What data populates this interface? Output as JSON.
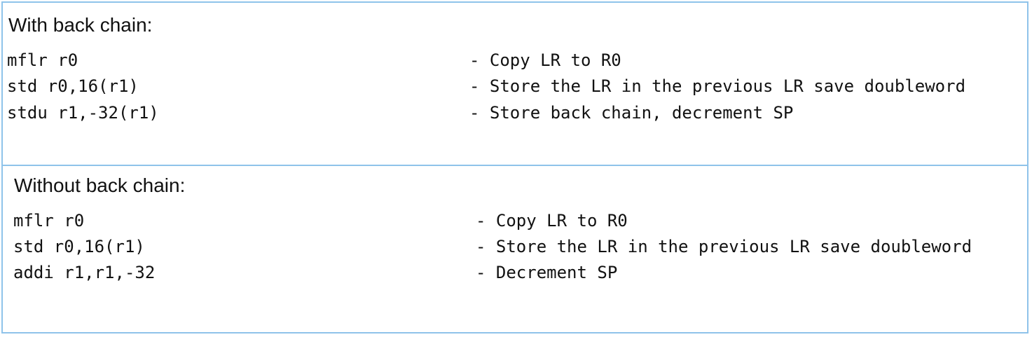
{
  "sections": [
    {
      "heading": "With back chain:",
      "rows": [
        {
          "instruction": "mflr r0",
          "description": "- Copy LR to R0"
        },
        {
          "instruction": "std r0,16(r1)",
          "description": "- Store the LR in the previous LR save doubleword"
        },
        {
          "instruction": "stdu r1,-32(r1)",
          "description": "- Store back chain, decrement SP"
        }
      ]
    },
    {
      "heading": "Without back chain:",
      "rows": [
        {
          "instruction": "mflr r0",
          "description": "- Copy LR to R0"
        },
        {
          "instruction": "std r0,16(r1)",
          "description": "- Store the LR in the previous LR save doubleword"
        },
        {
          "instruction": "addi r1,r1,-32",
          "description": "- Decrement SP"
        }
      ]
    }
  ],
  "colors": {
    "border": "#8fc3ea",
    "text": "#111111"
  }
}
